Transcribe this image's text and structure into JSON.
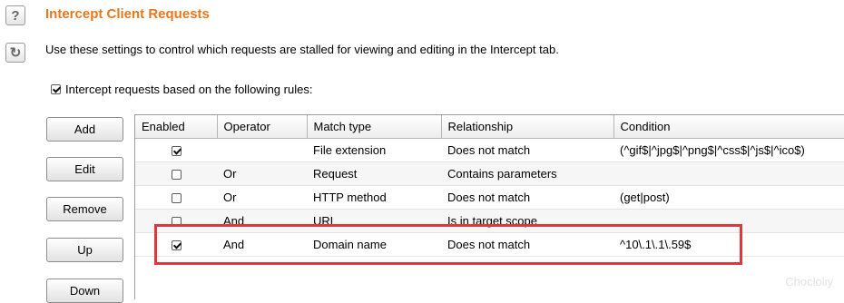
{
  "header": {
    "title": "Intercept Client Requests",
    "help_glyph": "?",
    "refresh_glyph": "↻",
    "description": "Use these settings to control which requests are stalled for viewing and editing in the Intercept tab."
  },
  "intercept_checkbox": {
    "label": "Intercept requests based on the following rules:",
    "checked": true
  },
  "buttons": {
    "add": "Add",
    "edit": "Edit",
    "remove": "Remove",
    "up": "Up",
    "down": "Down"
  },
  "table": {
    "columns": [
      "Enabled",
      "Operator",
      "Match type",
      "Relationship",
      "Condition"
    ],
    "rows": [
      {
        "enabled": true,
        "operator": "",
        "match_type": "File extension",
        "relationship": "Does not match",
        "condition": "(^gif$|^jpg$|^png$|^css$|^js$|^ico$)"
      },
      {
        "enabled": false,
        "operator": "Or",
        "match_type": "Request",
        "relationship": "Contains parameters",
        "condition": ""
      },
      {
        "enabled": false,
        "operator": "Or",
        "match_type": "HTTP method",
        "relationship": "Does not match",
        "condition": "(get|post)"
      },
      {
        "enabled": false,
        "operator": "And",
        "match_type": "URL",
        "relationship": "Is in target scope",
        "condition": ""
      },
      {
        "enabled": true,
        "operator": "And",
        "match_type": "Domain name",
        "relationship": "Does not match",
        "condition": "^10\\.1\\.1\\.59$"
      }
    ]
  },
  "watermark": "Chocloliy",
  "colors": {
    "title": "#e6781e",
    "highlight": "#e0383a"
  }
}
